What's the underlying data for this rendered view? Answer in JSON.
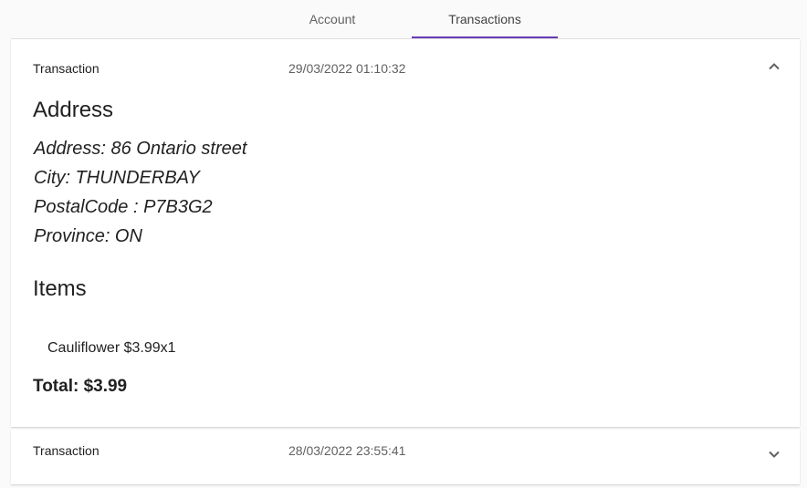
{
  "tabs": [
    {
      "label": "Account"
    },
    {
      "label": "Transactions"
    }
  ],
  "accent_color": "#673ab7",
  "transactions": [
    {
      "title": "Transaction",
      "date": "29/03/2022 01:10:32",
      "expanded": true,
      "expand_icon": "chevron-up-icon",
      "address_heading": "Address",
      "address_lines": [
        "Address: 86 Ontario street",
        "City: THUNDERBAY",
        "PostalCode : P7B3G2",
        "Province: ON"
      ],
      "items_heading": "Items",
      "items": [
        "Cauliflower $3.99x1"
      ],
      "total": "Total: $3.99"
    },
    {
      "title": "Transaction",
      "date": "28/03/2022 23:55:41",
      "expanded": false,
      "expand_icon": "chevron-down-icon"
    }
  ]
}
